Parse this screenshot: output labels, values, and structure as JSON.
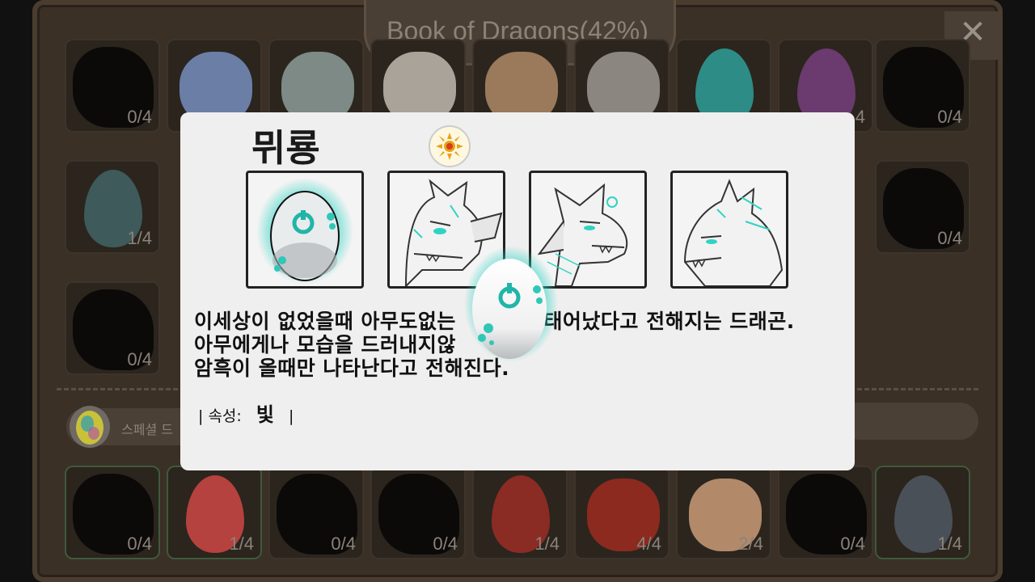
{
  "book": {
    "title": "Book of Dragons(42%)",
    "close_glyph": "✕",
    "special_label": "스페셜 드",
    "top_rows": [
      [
        {
          "kind": "silhouette",
          "count": "0/4"
        },
        {
          "kind": "dragon",
          "color": "#6b7ea6",
          "count": ""
        },
        {
          "kind": "dragon",
          "color": "#7d8a86",
          "count": ""
        },
        {
          "kind": "dragon",
          "color": "#a9a39a",
          "count": ""
        },
        {
          "kind": "dragon",
          "color": "#9a7a5a",
          "count": ""
        },
        {
          "kind": "dragon",
          "color": "#8b8680",
          "count": ""
        },
        {
          "kind": "egg",
          "color": "#2e8c86",
          "count": ""
        },
        {
          "kind": "egg",
          "color": "#6b3a6e",
          "count": "4"
        },
        {
          "kind": "silhouette",
          "count": "0/4"
        }
      ],
      [
        {
          "kind": "egg",
          "color": "#3e5a5a",
          "count": "1/4"
        },
        {
          "kind": "none",
          "count": ""
        },
        {
          "kind": "none",
          "count": ""
        },
        {
          "kind": "none",
          "count": ""
        },
        {
          "kind": "none",
          "count": ""
        },
        {
          "kind": "none",
          "count": ""
        },
        {
          "kind": "none",
          "count": ""
        },
        {
          "kind": "none",
          "count": ""
        },
        {
          "kind": "silhouette",
          "count": "0/4"
        }
      ],
      [
        {
          "kind": "silhouette",
          "count": "0/4"
        }
      ]
    ],
    "bottom_row": [
      {
        "kind": "silhouette",
        "count": "0/4",
        "owned": true
      },
      {
        "kind": "egg",
        "color": "#b5423e",
        "count": "1/4",
        "owned": true
      },
      {
        "kind": "silhouette",
        "count": "0/4",
        "owned": false
      },
      {
        "kind": "silhouette",
        "count": "0/4",
        "owned": false
      },
      {
        "kind": "egg",
        "color": "#8a2c24",
        "count": "1/4",
        "owned": false
      },
      {
        "kind": "dragon",
        "color": "#8c2a20",
        "count": "4/4",
        "owned": false
      },
      {
        "kind": "dragon",
        "color": "#b28a6a",
        "count": "2/4",
        "owned": false
      },
      {
        "kind": "silhouette",
        "count": "0/4",
        "owned": false
      },
      {
        "kind": "egg",
        "color": "#4a5058",
        "count": "1/4",
        "owned": true
      }
    ]
  },
  "popup": {
    "name": "뮈룡",
    "element_icon": "sun-icon",
    "stages": [
      "egg-stage",
      "baby-stage",
      "teen-stage",
      "adult-stage"
    ],
    "description": [
      "이세상이 없었을때 아무도없는",
      "태어났다고 전해지는 드래곤.",
      "아무에게나 모습을 드러내지않",
      "암흑이 올때만 나타난다고 전해진다."
    ],
    "attribute_label": "| 속성:",
    "attribute_value": "빛",
    "attribute_end": "|",
    "accent_color": "#2fd3c4"
  }
}
